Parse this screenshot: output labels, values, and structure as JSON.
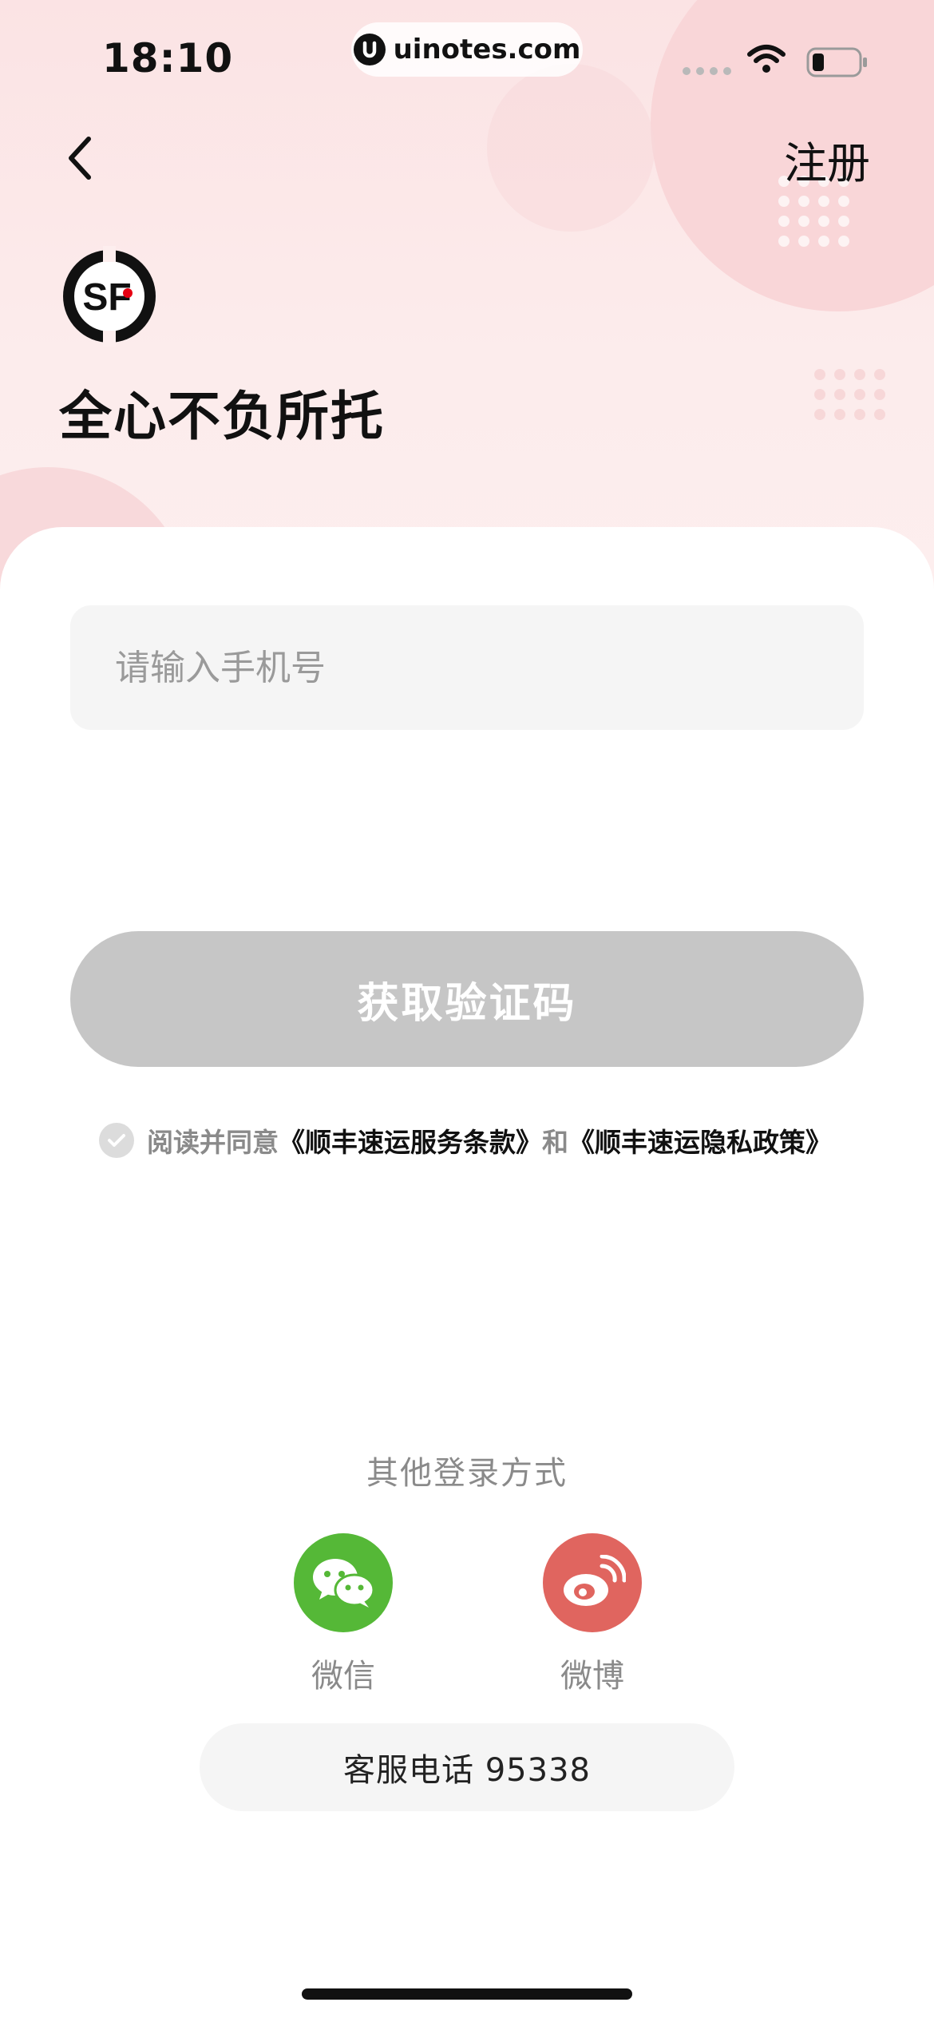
{
  "status_bar": {
    "time": "18:10",
    "url": "uinotes.com"
  },
  "nav": {
    "register_label": "注册"
  },
  "brand": {
    "slogan": "全心不负所托",
    "accent_color": "#e60012"
  },
  "form": {
    "phone_placeholder": "请输入手机号",
    "get_code_label": "获取验证码",
    "agreement": {
      "prefix": "阅读并同意",
      "terms_link": "《顺丰速运服务条款》",
      "conjunction": "和",
      "privacy_link": "《顺丰速运隐私政策》"
    }
  },
  "other_login": {
    "title": "其他登录方式",
    "options": [
      {
        "label": "微信",
        "icon": "wechat-icon",
        "color": "#55b837"
      },
      {
        "label": "微博",
        "icon": "weibo-icon",
        "color": "#e0655f"
      }
    ]
  },
  "service": {
    "label": "客服电话 95338"
  }
}
